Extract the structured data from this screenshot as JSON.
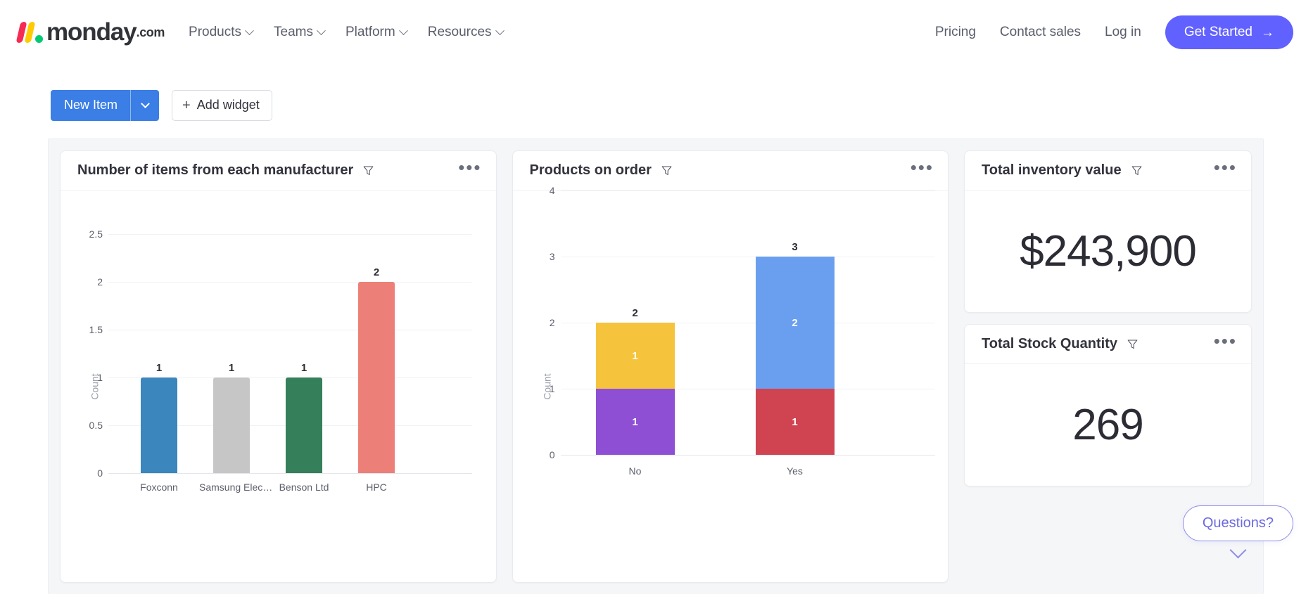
{
  "site_nav": {
    "brand": {
      "word": "monday",
      "suffix": ".com",
      "logo_icon": "monday-logo-icon"
    },
    "left_items": [
      {
        "label": "Products",
        "icon": "chevron-down-icon"
      },
      {
        "label": "Teams",
        "icon": "chevron-down-icon"
      },
      {
        "label": "Platform",
        "icon": "chevron-down-icon"
      },
      {
        "label": "Resources",
        "icon": "chevron-down-icon"
      }
    ],
    "right_links": [
      "Pricing",
      "Contact sales",
      "Log in"
    ],
    "cta": {
      "label": "Get Started",
      "arrow": "→",
      "color": "#6161FF"
    }
  },
  "toolbar": {
    "new_item_label": "New Item",
    "new_item_color": "#3A7EE6",
    "new_item_caret_icon": "chevron-down-icon",
    "add_widget_label": "Add widget",
    "add_widget_icon": "plus-icon"
  },
  "widgets": {
    "manufacturer_chart": {
      "title": "Number of items from each manufacturer",
      "filter_icon": "funnel-icon",
      "menu_icon": "ellipsis-icon"
    },
    "orders_chart": {
      "title": "Products on order",
      "filter_icon": "funnel-icon",
      "menu_icon": "ellipsis-icon"
    },
    "inventory_value": {
      "title": "Total inventory value",
      "filter_icon": "funnel-icon",
      "menu_icon": "ellipsis-icon",
      "value": "$243,900"
    },
    "stock_quantity": {
      "title": "Total Stock Quantity",
      "filter_icon": "funnel-icon",
      "menu_icon": "ellipsis-icon",
      "value": "269"
    }
  },
  "chat_widget": {
    "label": "Questions?",
    "collapse_icon": "chevron-down-icon",
    "accent": "#6C6AE0"
  },
  "chart_data": [
    {
      "id": "manufacturer_chart",
      "type": "bar",
      "title": "Number of items from each manufacturer",
      "xlabel": "",
      "ylabel": "Count",
      "ylim": [
        0,
        2.7
      ],
      "yticks": [
        0,
        0.5,
        1,
        1.5,
        2,
        2.5
      ],
      "ytick_labels": [
        "0",
        "0.5",
        "1",
        "1.5",
        "2",
        "2.5"
      ],
      "grid": true,
      "legend": "none",
      "categories": [
        "Foxconn",
        "Samsung Elec…",
        "Benson Ltd",
        "HPC"
      ],
      "values": [
        1,
        1,
        1,
        2
      ],
      "value_labels": [
        "1",
        "1",
        "1",
        "2"
      ],
      "colors": [
        "#3B86BC",
        "#C6C6C6",
        "#35805A",
        "#EC8078"
      ]
    },
    {
      "id": "orders_chart",
      "type": "bar",
      "title": "Products on order",
      "xlabel": "",
      "ylabel": "Count",
      "ylim": [
        0,
        4.2
      ],
      "yticks": [
        0,
        1,
        2,
        3,
        4
      ],
      "ytick_labels": [
        "0",
        "1",
        "2",
        "3",
        "4"
      ],
      "grid": true,
      "stacked": true,
      "legend": "none",
      "categories": [
        "No",
        "Yes"
      ],
      "totals": [
        2,
        3
      ],
      "total_labels": [
        "2",
        "3"
      ],
      "stacks": [
        {
          "category": "No",
          "segments": [
            {
              "value": 1,
              "label": "1",
              "color": "#8E4FD4"
            },
            {
              "value": 1,
              "label": "1",
              "color": "#F6C33C"
            }
          ]
        },
        {
          "category": "Yes",
          "segments": [
            {
              "value": 1,
              "label": "1",
              "color": "#D04350"
            },
            {
              "value": 2,
              "label": "2",
              "color": "#6A9FF0"
            }
          ]
        }
      ]
    }
  ]
}
